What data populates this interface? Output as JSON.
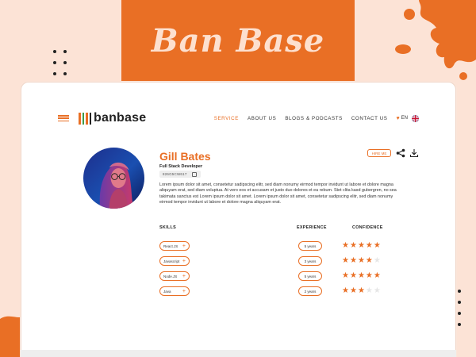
{
  "banner": {
    "title": "Ban Base"
  },
  "colors": {
    "accent": "#e96f25",
    "background": "#fce3d6",
    "logo_bars": [
      "#e96f25",
      "#3b9b48",
      "#e96f25",
      "#222222"
    ]
  },
  "nav": {
    "brand": "banbase",
    "links": [
      {
        "label": "SERVICE",
        "active": true
      },
      {
        "label": "ABOUT US",
        "active": false
      },
      {
        "label": "BLOGS & PODCASTS",
        "active": false
      },
      {
        "label": "CONTACT US",
        "active": false
      }
    ],
    "language": "EN",
    "icons": {
      "menu": "hamburger-icon",
      "favorite": "heart-icon",
      "flag": "uk-flag-icon"
    }
  },
  "profile": {
    "name": "Gill Bates",
    "role": "Full Stack Developer",
    "id": "826G5CW617",
    "bio": "Lorem ipsum dolor sit amet, consetetur sadipscing elitr, sed diam nonumy eirmod tempor invidunt ut labore et dolore magna aliquyam erat, sed diam voluptua. At vero eos et accusam et justo duo dolores et ea rebum. Stet clita kasd gubergren, no sea takimata sanctus est Lorem ipsum dolor sit amet. Lorem ipsum dolor sit amet, consetetur sadipscing elitr, sed diam nonumy eirmod tempor invidunt ut labore et dolore magna aliquyam erat.",
    "hire_label": "HIRE ME",
    "icons": {
      "copy": "copy-icon",
      "share": "share-icon",
      "download": "download-icon"
    }
  },
  "skills": {
    "headers": {
      "skills": "SKILLS",
      "experience": "EXPERIENCE",
      "confidence": "CONFIDENCE"
    },
    "rows": [
      {
        "skill": "React.JS",
        "experience": "5 years",
        "confidence": 5
      },
      {
        "skill": "Javascript",
        "experience": "3 years",
        "confidence": 4
      },
      {
        "skill": "Node.JS",
        "experience": "5 years",
        "confidence": 5
      },
      {
        "skill": "Java",
        "experience": "2 years",
        "confidence": 3
      }
    ],
    "max_confidence": 5
  }
}
